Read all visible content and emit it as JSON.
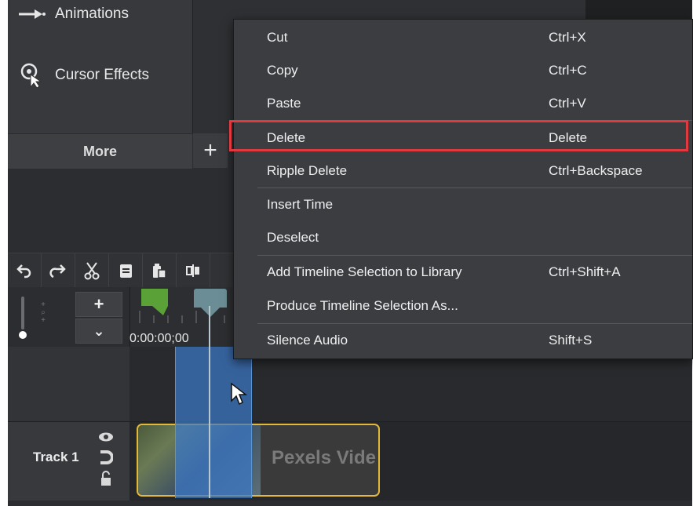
{
  "tools": [
    {
      "label": "Animations",
      "icon": "animations-icon"
    },
    {
      "label": "Cursor Effects",
      "icon": "cursor-effects-icon"
    }
  ],
  "more_label": "More",
  "plus_label": "+",
  "timeline": {
    "time": "0:00:00;00",
    "track_label": "Track 1",
    "clip_label": "Pexels Vide"
  },
  "zoom": {
    "in_label": "+",
    "out_label": "⌄"
  },
  "context_menu": {
    "items": [
      {
        "label": "Cut",
        "shortcut": "Ctrl+X"
      },
      {
        "label": "Copy",
        "shortcut": "Ctrl+C"
      },
      {
        "label": "Paste",
        "shortcut": "Ctrl+V"
      },
      {
        "label": "Delete",
        "shortcut": "Delete"
      },
      {
        "label": "Ripple Delete",
        "shortcut": "Ctrl+Backspace"
      },
      {
        "label": "Insert Time",
        "shortcut": ""
      },
      {
        "label": "Deselect",
        "shortcut": ""
      },
      {
        "label": "Add Timeline Selection to Library",
        "shortcut": "Ctrl+Shift+A"
      },
      {
        "label": "Produce Timeline Selection As...",
        "shortcut": ""
      },
      {
        "label": "Silence Audio",
        "shortcut": "Shift+S"
      }
    ]
  },
  "colors": {
    "highlight": "#e0393f",
    "clip_border": "#e4b93a",
    "selection": "#3c78c8",
    "marker": "#5aa237"
  }
}
